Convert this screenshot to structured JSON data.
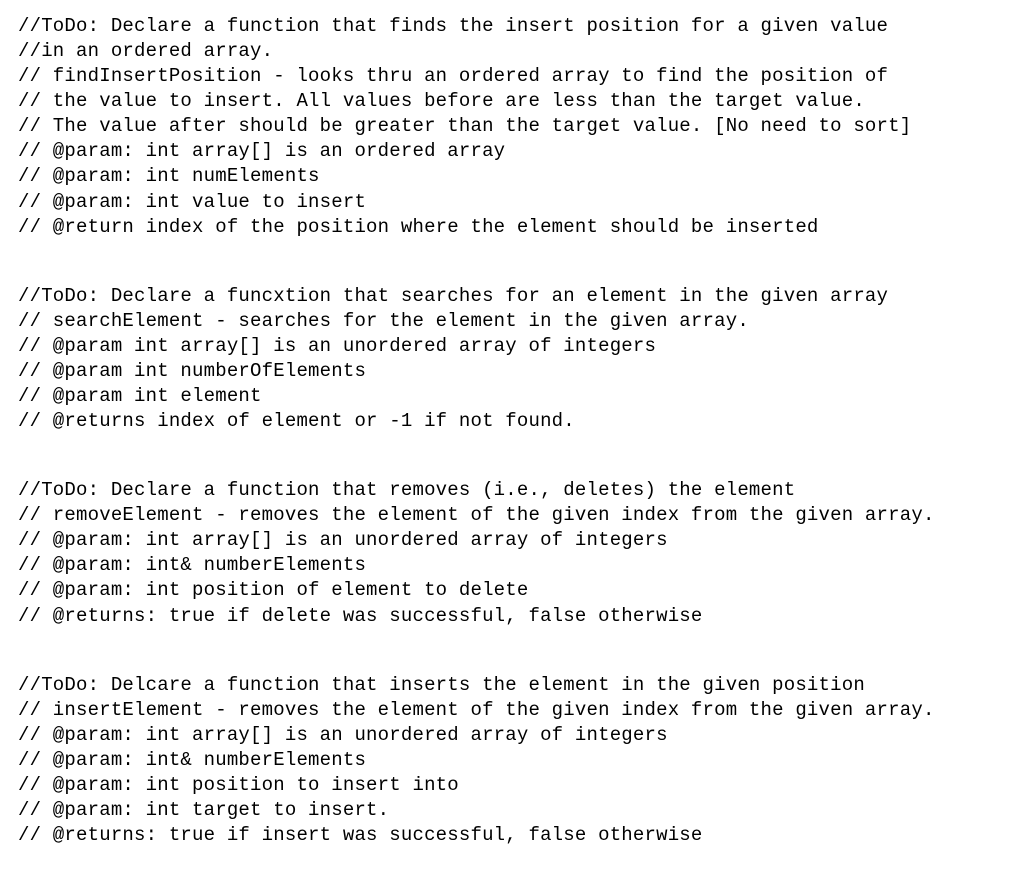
{
  "blocks": [
    {
      "lines": [
        "//ToDo: Declare a function that finds the insert position for a given value",
        "//in an ordered array.",
        "// findInsertPosition - looks thru an ordered array to find the position of",
        "// the value to insert. All values before are less than the target value.",
        "// The value after should be greater than the target value. [No need to sort]",
        "// @param: int array[] is an ordered array",
        "// @param: int numElements",
        "// @param: int value to insert",
        "// @return index of the position where the element should be inserted"
      ]
    },
    {
      "lines": [
        "//ToDo: Declare a funcxtion that searches for an element in the given array",
        "// searchElement - searches for the element in the given array.",
        "// @param int array[] is an unordered array of integers",
        "// @param int numberOfElements",
        "// @param int element",
        "// @returns index of element or -1 if not found."
      ]
    },
    {
      "lines": [
        "//ToDo: Declare a function that removes (i.e., deletes) the element",
        "// removeElement - removes the element of the given index from the given array.",
        "// @param: int array[] is an unordered array of integers",
        "// @param: int& numberElements",
        "// @param: int position of element to delete",
        "// @returns: true if delete was successful, false otherwise"
      ]
    },
    {
      "lines": [
        "//ToDo: Delcare a function that inserts the element in the given position",
        "// insertElement - removes the element of the given index from the given array.",
        "// @param: int array[] is an unordered array of integers",
        "// @param: int& numberElements",
        "// @param: int position to insert into",
        "// @param: int target to insert.",
        "// @returns: true if insert was successful, false otherwise"
      ]
    }
  ]
}
